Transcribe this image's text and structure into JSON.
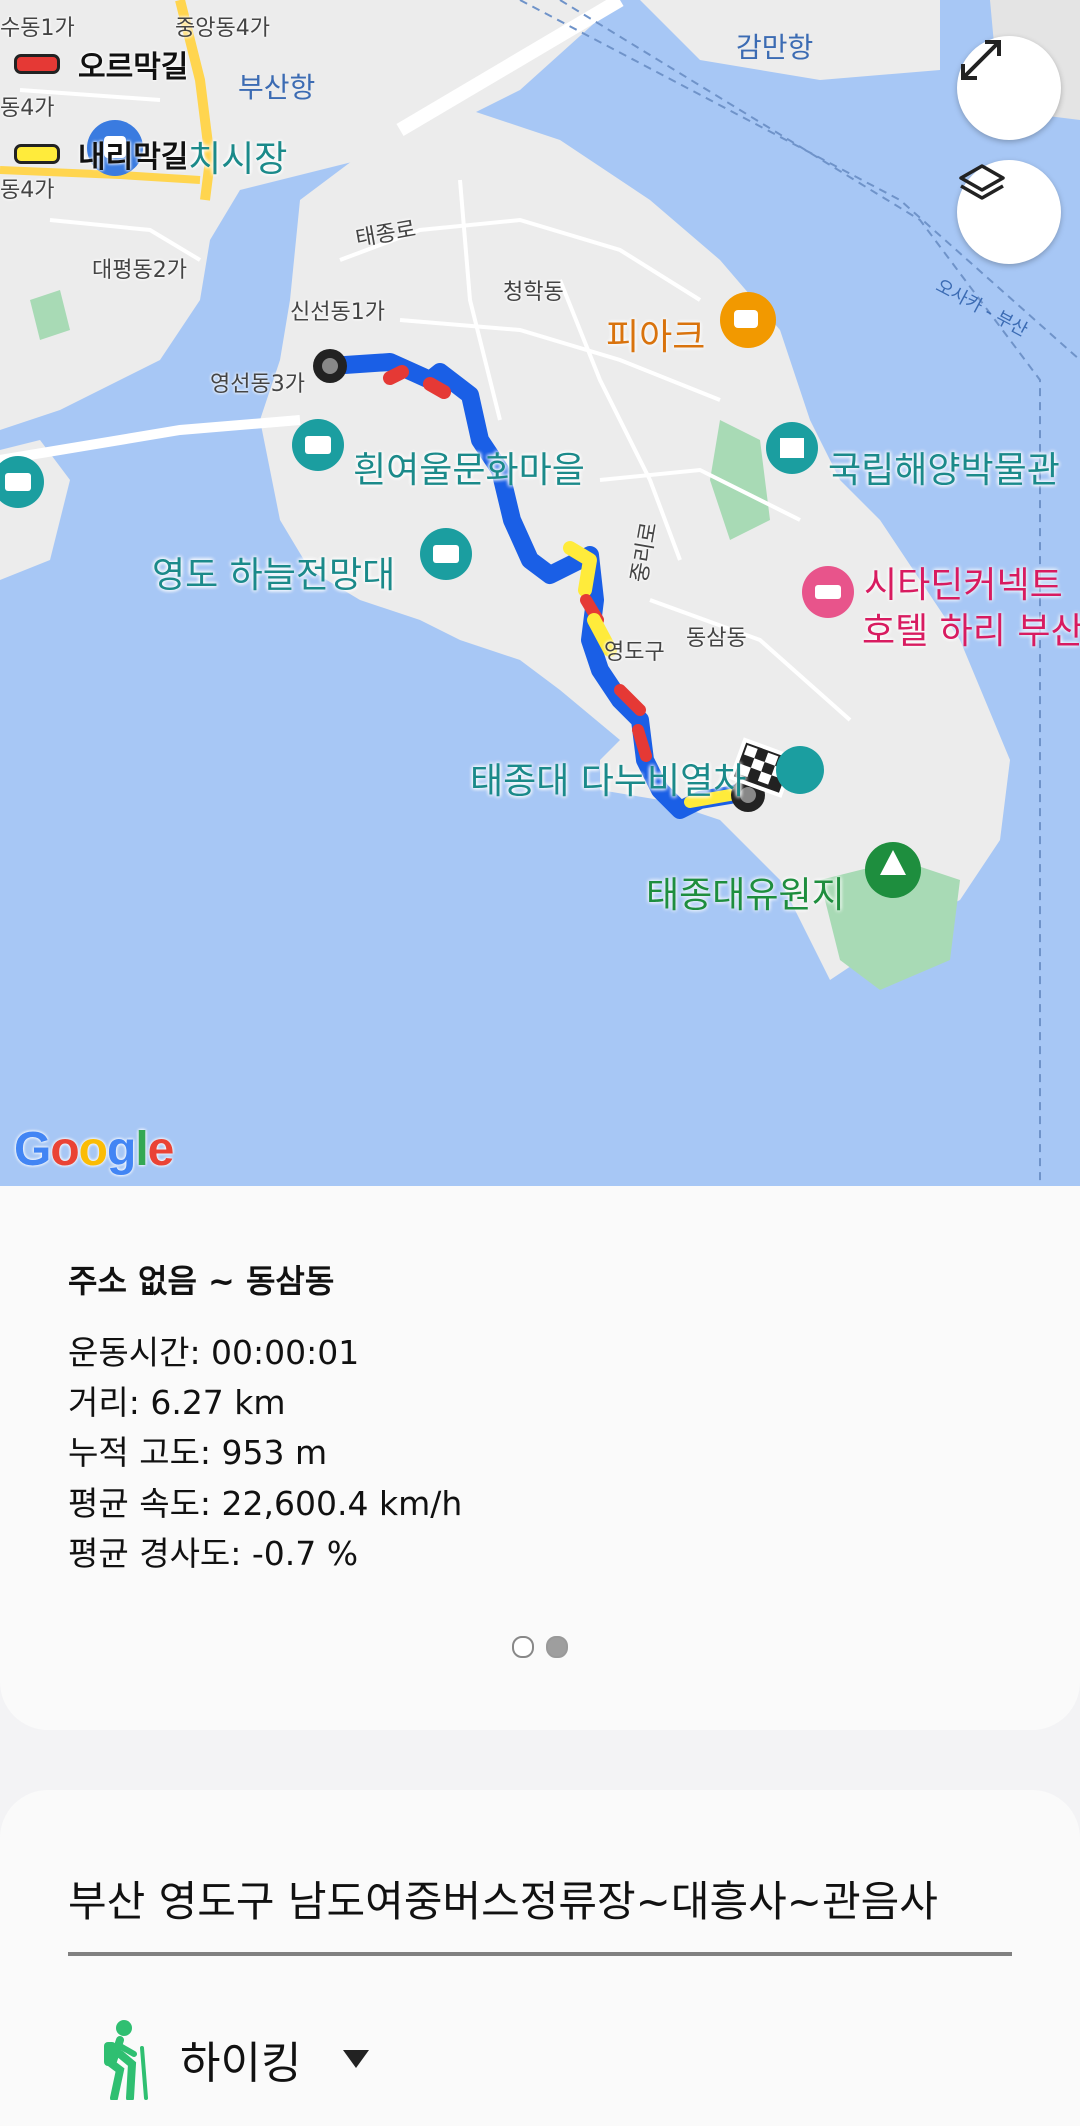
{
  "legend": [
    {
      "label": "오르막길",
      "color": "#e53935"
    },
    {
      "label": "내리막길",
      "color": "#ffeb3b"
    }
  ],
  "map": {
    "colors": {
      "water": "#a7c7f5",
      "land": "#ececec",
      "park": "#a8dab5",
      "road_major": "#ffd54f",
      "route": "#1a5fe6"
    },
    "district_labels": [
      "수동1가",
      "중앙동4가",
      "동4가",
      "동4가",
      "대평동2가",
      "신선동1가",
      "영선동3가",
      "청학동",
      "동삼동",
      "영도구",
      "태종로",
      "중리로"
    ],
    "water_labels": [
      "부산항",
      "감만항"
    ],
    "sea_label": "오사카 - 부산",
    "poi_labels": {
      "market": "치시장",
      "cafe": "피아크",
      "village": "흰여울문화마을",
      "museum": "국립해양박물관",
      "observatory": "영도 하늘전망대",
      "hotel_line1": "시타딘커넥트",
      "hotel_line2": "호텔 하리 부산",
      "park_spot": "태종대 다누비열차",
      "resort": "태종대유원지"
    },
    "icons": [
      "expand-icon",
      "layers-icon",
      "start-marker-icon",
      "finish-flag-icon",
      "camera-poi-icon",
      "cafe-poi-icon",
      "museum-poi-icon",
      "hotel-poi-icon",
      "tree-poi-icon",
      "bus-poi-icon"
    ],
    "attribution": "Google"
  },
  "summary": {
    "route_title": "주소 없음 ~ 동삼동",
    "time": "운동시간: 00:00:01",
    "distance": "거리: 6.27 km",
    "elevation": "누적 고도: 953 m",
    "avg_speed": "평균 속도: 22,600.4 km/h",
    "avg_slope": "평균 경사도: -0.7 %",
    "page_indicator": {
      "total": 2,
      "active": 2
    }
  },
  "course": {
    "title": "부산 영도구 남도여중버스정류장~대흥사~관음사",
    "activity": "하이킹",
    "activity_icon": "hiking-icon",
    "dropdown_icon": "caret-down-icon"
  }
}
